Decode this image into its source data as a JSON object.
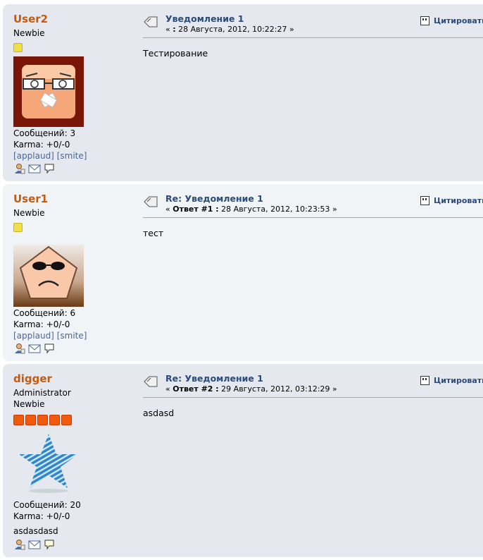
{
  "posts": [
    {
      "username": "User2",
      "group": "",
      "rank": "Newbie",
      "stars": 1,
      "avatar": "scared-face-avatar",
      "messages": "Сообщений: 3",
      "karma": "Karma: +0/-0",
      "applaud": "[applaud]",
      "smite": "[smite]",
      "signature": "",
      "title": "Уведомление 1",
      "date_prefix": "« ",
      "reply": ":",
      "date": " 28 Августа, 2012, 10:22:27 »",
      "quote": "Цитировать",
      "text": "Тестирование"
    },
    {
      "username": "User1",
      "group": "",
      "rank": "Newbie",
      "stars": 1,
      "avatar": "sunglasses-pentagon-avatar",
      "messages": "Сообщений: 6",
      "karma": "Karma: +0/-0",
      "applaud": "[applaud]",
      "smite": "[smite]",
      "signature": "",
      "title": "Re: Уведомление 1",
      "date_prefix": "« ",
      "reply": "Ответ #1 :",
      "date": " 28 Августа, 2012, 10:23:53 »",
      "quote": "Цитировать",
      "text": "тест"
    },
    {
      "username": "digger",
      "group": "Administrator",
      "rank": "Newbie",
      "stars": 5,
      "avatar": "blue-star-avatar",
      "messages": "Сообщений: 20",
      "karma": "Karma: +0/-0",
      "applaud": "",
      "smite": "",
      "signature": "asdasdasd",
      "title": "Re: Уведомление 1",
      "date_prefix": "« ",
      "reply": "Ответ #2 :",
      "date": " 29 Августа, 2012, 03:12:29 »",
      "quote": "Цитировать",
      "text": "asdasd"
    }
  ],
  "colors": {
    "username": "#c15b12",
    "title": "#2b4b7a",
    "link": "#4a6796",
    "post_bg_a": "#e5e8ee",
    "post_bg_b": "#f0f4f7"
  }
}
